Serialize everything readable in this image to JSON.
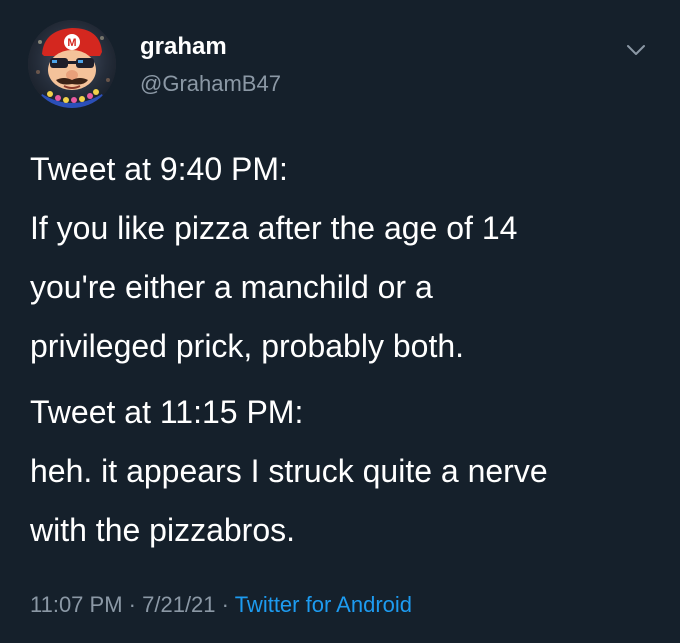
{
  "user": {
    "display_name": "graham",
    "handle": "@GrahamB47"
  },
  "tweet": {
    "lines": [
      "Tweet at 9:40 PM:",
      "If you like pizza after the age of 14",
      "you're either a manchild or a",
      "privileged prick, probably both.",
      "Tweet at 11:15 PM:",
      "heh. it appears I struck quite a nerve",
      "with the pizzabros."
    ]
  },
  "footer": {
    "time": "11:07 PM",
    "separator": "·",
    "date": "7/21/21",
    "source": "Twitter for Android"
  },
  "icons": {
    "menu": "chevron-down-icon",
    "avatar": "mario-avatar"
  },
  "colors": {
    "background": "#15202b",
    "text": "#ffffff",
    "muted": "#8b98a5",
    "link": "#1d9bf0"
  }
}
